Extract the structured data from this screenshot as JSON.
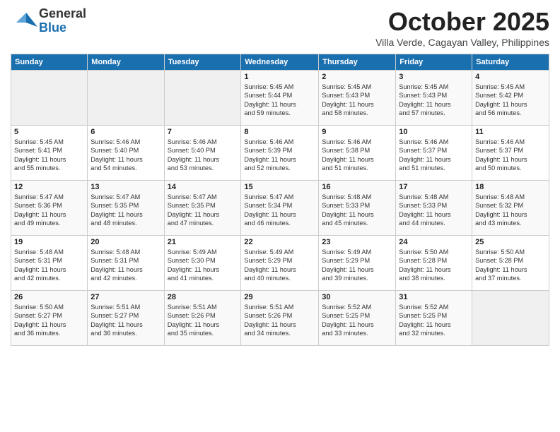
{
  "logo": {
    "general": "General",
    "blue": "Blue"
  },
  "header": {
    "month": "October 2025",
    "subtitle": "Villa Verde, Cagayan Valley, Philippines"
  },
  "weekdays": [
    "Sunday",
    "Monday",
    "Tuesday",
    "Wednesday",
    "Thursday",
    "Friday",
    "Saturday"
  ],
  "weeks": [
    [
      {
        "day": "",
        "info": ""
      },
      {
        "day": "",
        "info": ""
      },
      {
        "day": "",
        "info": ""
      },
      {
        "day": "1",
        "info": "Sunrise: 5:45 AM\nSunset: 5:44 PM\nDaylight: 11 hours\nand 59 minutes."
      },
      {
        "day": "2",
        "info": "Sunrise: 5:45 AM\nSunset: 5:43 PM\nDaylight: 11 hours\nand 58 minutes."
      },
      {
        "day": "3",
        "info": "Sunrise: 5:45 AM\nSunset: 5:43 PM\nDaylight: 11 hours\nand 57 minutes."
      },
      {
        "day": "4",
        "info": "Sunrise: 5:45 AM\nSunset: 5:42 PM\nDaylight: 11 hours\nand 56 minutes."
      }
    ],
    [
      {
        "day": "5",
        "info": "Sunrise: 5:45 AM\nSunset: 5:41 PM\nDaylight: 11 hours\nand 55 minutes."
      },
      {
        "day": "6",
        "info": "Sunrise: 5:46 AM\nSunset: 5:40 PM\nDaylight: 11 hours\nand 54 minutes."
      },
      {
        "day": "7",
        "info": "Sunrise: 5:46 AM\nSunset: 5:40 PM\nDaylight: 11 hours\nand 53 minutes."
      },
      {
        "day": "8",
        "info": "Sunrise: 5:46 AM\nSunset: 5:39 PM\nDaylight: 11 hours\nand 52 minutes."
      },
      {
        "day": "9",
        "info": "Sunrise: 5:46 AM\nSunset: 5:38 PM\nDaylight: 11 hours\nand 51 minutes."
      },
      {
        "day": "10",
        "info": "Sunrise: 5:46 AM\nSunset: 5:37 PM\nDaylight: 11 hours\nand 51 minutes."
      },
      {
        "day": "11",
        "info": "Sunrise: 5:46 AM\nSunset: 5:37 PM\nDaylight: 11 hours\nand 50 minutes."
      }
    ],
    [
      {
        "day": "12",
        "info": "Sunrise: 5:47 AM\nSunset: 5:36 PM\nDaylight: 11 hours\nand 49 minutes."
      },
      {
        "day": "13",
        "info": "Sunrise: 5:47 AM\nSunset: 5:35 PM\nDaylight: 11 hours\nand 48 minutes."
      },
      {
        "day": "14",
        "info": "Sunrise: 5:47 AM\nSunset: 5:35 PM\nDaylight: 11 hours\nand 47 minutes."
      },
      {
        "day": "15",
        "info": "Sunrise: 5:47 AM\nSunset: 5:34 PM\nDaylight: 11 hours\nand 46 minutes."
      },
      {
        "day": "16",
        "info": "Sunrise: 5:48 AM\nSunset: 5:33 PM\nDaylight: 11 hours\nand 45 minutes."
      },
      {
        "day": "17",
        "info": "Sunrise: 5:48 AM\nSunset: 5:33 PM\nDaylight: 11 hours\nand 44 minutes."
      },
      {
        "day": "18",
        "info": "Sunrise: 5:48 AM\nSunset: 5:32 PM\nDaylight: 11 hours\nand 43 minutes."
      }
    ],
    [
      {
        "day": "19",
        "info": "Sunrise: 5:48 AM\nSunset: 5:31 PM\nDaylight: 11 hours\nand 42 minutes."
      },
      {
        "day": "20",
        "info": "Sunrise: 5:48 AM\nSunset: 5:31 PM\nDaylight: 11 hours\nand 42 minutes."
      },
      {
        "day": "21",
        "info": "Sunrise: 5:49 AM\nSunset: 5:30 PM\nDaylight: 11 hours\nand 41 minutes."
      },
      {
        "day": "22",
        "info": "Sunrise: 5:49 AM\nSunset: 5:29 PM\nDaylight: 11 hours\nand 40 minutes."
      },
      {
        "day": "23",
        "info": "Sunrise: 5:49 AM\nSunset: 5:29 PM\nDaylight: 11 hours\nand 39 minutes."
      },
      {
        "day": "24",
        "info": "Sunrise: 5:50 AM\nSunset: 5:28 PM\nDaylight: 11 hours\nand 38 minutes."
      },
      {
        "day": "25",
        "info": "Sunrise: 5:50 AM\nSunset: 5:28 PM\nDaylight: 11 hours\nand 37 minutes."
      }
    ],
    [
      {
        "day": "26",
        "info": "Sunrise: 5:50 AM\nSunset: 5:27 PM\nDaylight: 11 hours\nand 36 minutes."
      },
      {
        "day": "27",
        "info": "Sunrise: 5:51 AM\nSunset: 5:27 PM\nDaylight: 11 hours\nand 36 minutes."
      },
      {
        "day": "28",
        "info": "Sunrise: 5:51 AM\nSunset: 5:26 PM\nDaylight: 11 hours\nand 35 minutes."
      },
      {
        "day": "29",
        "info": "Sunrise: 5:51 AM\nSunset: 5:26 PM\nDaylight: 11 hours\nand 34 minutes."
      },
      {
        "day": "30",
        "info": "Sunrise: 5:52 AM\nSunset: 5:25 PM\nDaylight: 11 hours\nand 33 minutes."
      },
      {
        "day": "31",
        "info": "Sunrise: 5:52 AM\nSunset: 5:25 PM\nDaylight: 11 hours\nand 32 minutes."
      },
      {
        "day": "",
        "info": ""
      }
    ]
  ]
}
